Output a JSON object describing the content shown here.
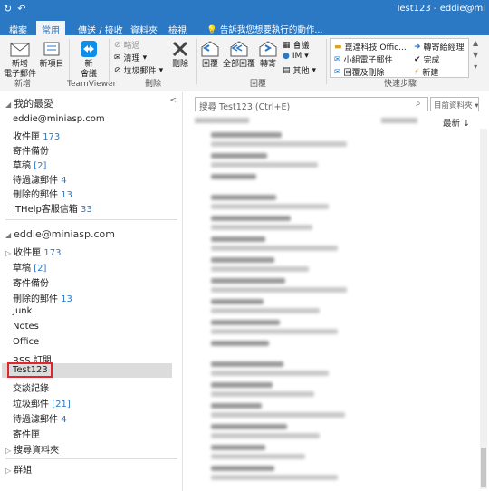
{
  "titlebar": {
    "title": "Test123 - eddie@mi",
    "undo_icon": "↶",
    "sync_icon": "↻"
  },
  "tabs": [
    "檔案",
    "常用",
    "傳送 / 接收",
    "資料夾",
    "檢視"
  ],
  "tell_me": "告訴我您想要執行的動作...",
  "ribbon": {
    "new_email": "新增\n電子郵件",
    "new_items": "新項目",
    "group_new": "新增",
    "teamviewer_meeting": "新\n會議",
    "group_teamviewer": "TeamViewer",
    "ignore": "略過",
    "cleanup": "清理",
    "junk": "垃圾郵件",
    "delete": "刪除",
    "group_delete": "刪除",
    "reply": "回覆",
    "reply_all": "全部回覆",
    "forward": "轉寄",
    "meeting": "會議",
    "im": "IM",
    "more": "其他",
    "group_respond": "回覆",
    "quick_steps": [
      "崑達科技 Offic...",
      "小組電子郵件",
      "回覆及刪除",
      "轉寄給經理",
      "完成",
      "新建"
    ],
    "group_quicksteps": "快速步驟"
  },
  "favorites": {
    "header": "我的最愛",
    "account": "eddie@miniasp.com",
    "items": [
      {
        "label": "收件匣",
        "count": "173"
      },
      {
        "label": "寄件備份",
        "count": ""
      },
      {
        "label": "草稿",
        "count": "[2]"
      },
      {
        "label": "待過濾郵件",
        "count": "4"
      },
      {
        "label": "刪除的郵件",
        "count": "13"
      },
      {
        "label": "ITHelp客服信箱",
        "count": "33"
      }
    ]
  },
  "mailbox": {
    "account": "eddie@miniasp.com",
    "items": [
      {
        "label": "收件匣",
        "count": "173",
        "expand": true
      },
      {
        "label": "草稿",
        "count": "[2]"
      },
      {
        "label": "寄件備份",
        "count": ""
      },
      {
        "label": "刪除的郵件",
        "count": "13"
      },
      {
        "label": "Junk",
        "count": ""
      },
      {
        "label": "Notes",
        "count": ""
      },
      {
        "label": "Office",
        "count": ""
      },
      {
        "label": "RSS 訂閱",
        "count": ""
      },
      {
        "label": "Test123",
        "count": "",
        "selected": true
      },
      {
        "label": "交談記錄",
        "count": ""
      },
      {
        "label": "垃圾郵件",
        "count": "[21]"
      },
      {
        "label": "待過濾郵件",
        "count": "4"
      },
      {
        "label": "寄件匣",
        "count": ""
      },
      {
        "label": "搜尋資料夾",
        "count": "",
        "expand": true
      }
    ],
    "groups": "群組"
  },
  "messages": {
    "search_placeholder": "搜尋 Test123 (Ctrl+E)",
    "scope": "目前資料夾",
    "sort": "最新 ↓"
  },
  "colors": {
    "accent": "#2b78c5",
    "selected": "#dcdcdc",
    "highlight_box": "#e0262b"
  }
}
